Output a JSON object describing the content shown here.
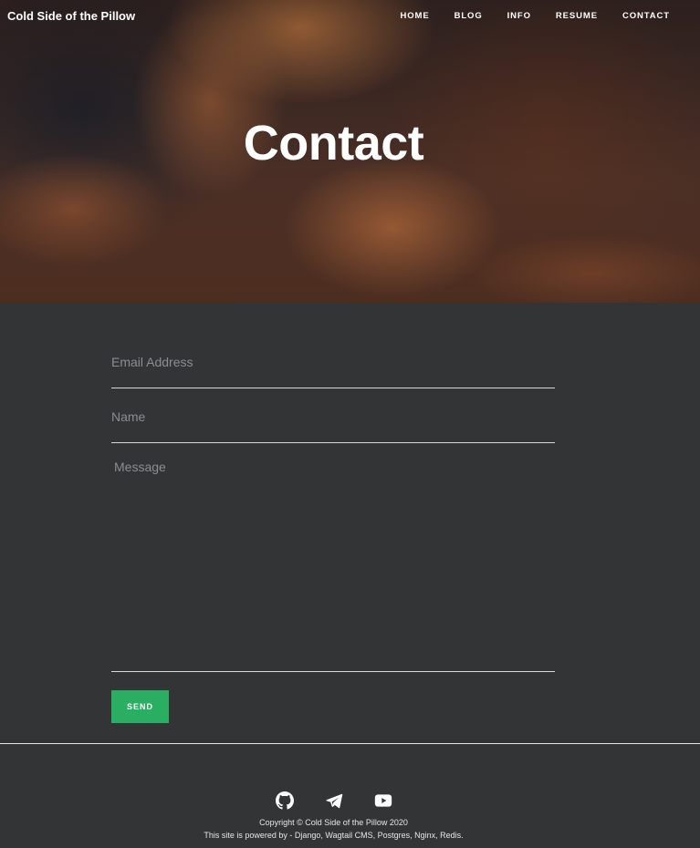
{
  "header": {
    "brand": "Cold Side of the Pillow",
    "nav": [
      {
        "label": "HOME"
      },
      {
        "label": "BLOG"
      },
      {
        "label": "INFO"
      },
      {
        "label": "RESUME"
      },
      {
        "label": "CONTACT"
      }
    ]
  },
  "hero": {
    "title": "Contact"
  },
  "form": {
    "email_placeholder": "Email Address",
    "name_placeholder": "Name",
    "message_placeholder": "Message",
    "send_label": "SEND"
  },
  "footer": {
    "icons": [
      "github-icon",
      "telegram-icon",
      "youtube-icon"
    ],
    "copyright": "Copyright © Cold Side of the Pillow 2020",
    "powered": "This site is powered by - Django, Wagtail CMS, Postgres, Nginx, Redis."
  },
  "colors": {
    "background": "#333436",
    "accent": "#2aae62",
    "text": "#ffffff"
  }
}
